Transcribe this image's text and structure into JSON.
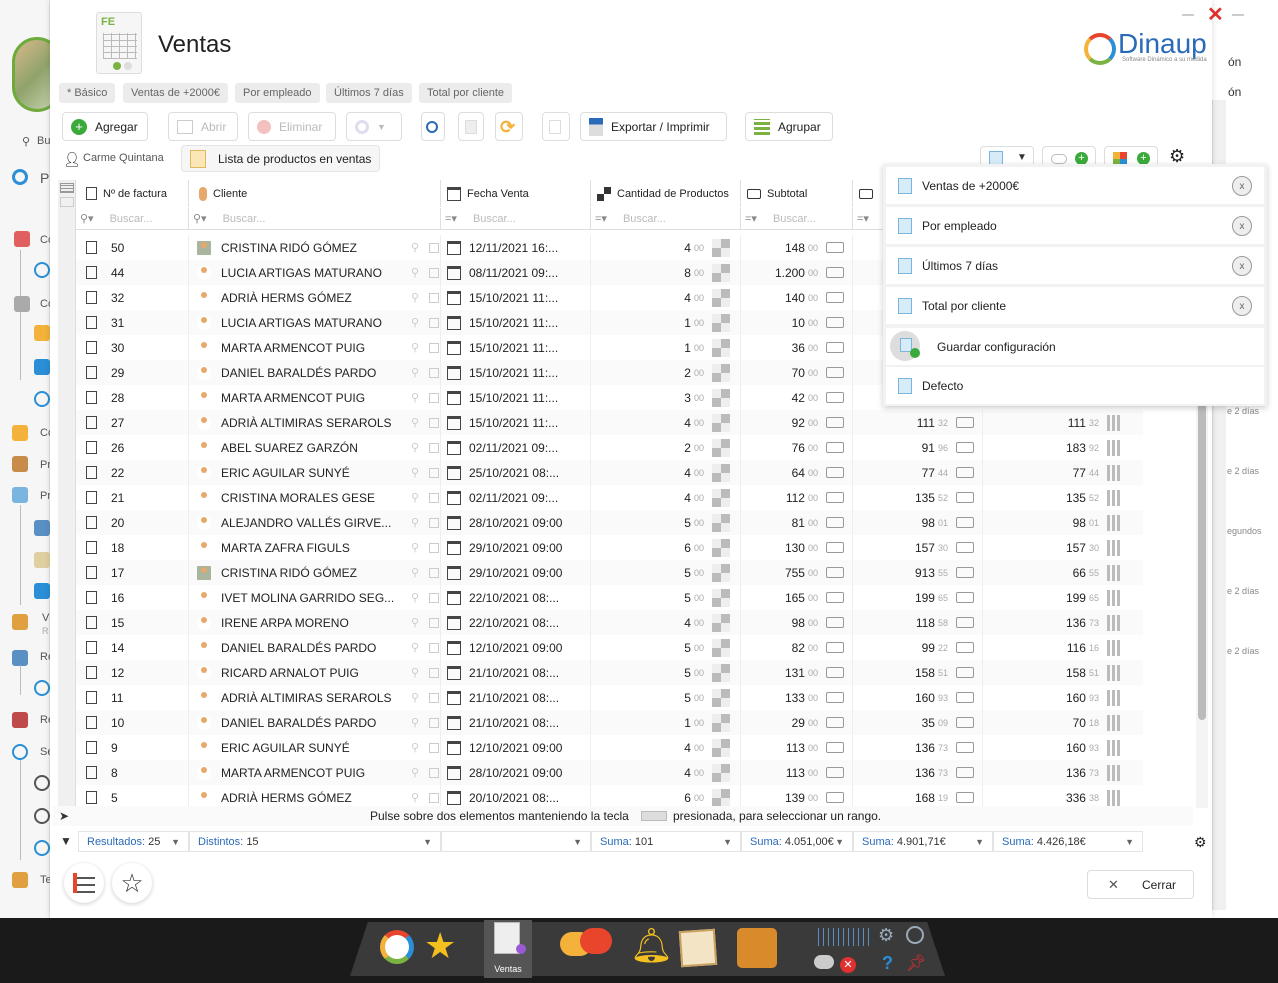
{
  "window": {
    "title": "Ventas",
    "close_icon": "close-icon",
    "brand": "Dinaup",
    "brand_tagline": "Software Dinámico a su medida"
  },
  "view_tabs": [
    "* Básico",
    "Ventas de +2000€",
    "Por empleado",
    "Últimos 7 días",
    "Total por cliente"
  ],
  "toolbar": {
    "add": "Agregar",
    "open": "Abrir",
    "delete": "Eliminar",
    "export": "Exportar / Imprimir",
    "group": "Agrupar"
  },
  "context": {
    "user": "Carme Quintana",
    "list_name": "Lista de productos en ventas"
  },
  "columns": {
    "invoice": "Nº de factura",
    "client": "Cliente",
    "date": "Fecha Venta",
    "qty": "Cantidad de Productos",
    "subtotal": "Subtotal"
  },
  "search_placeholder": "Buscar...",
  "rows": [
    {
      "id": "50",
      "client": "CRISTINA RIDÓ GÓMEZ",
      "date": "12/11/2021 16:...",
      "qty": "4",
      "sub": "148",
      "tot": "",
      "acc": ""
    },
    {
      "id": "44",
      "client": "LUCIA ARTIGAS MATURANO",
      "date": "08/11/2021 09:...",
      "qty": "8",
      "sub": "1.200",
      "tot": "",
      "acc": ""
    },
    {
      "id": "32",
      "client": "ADRIÀ HERMS GÓMEZ",
      "date": "15/10/2021 11:...",
      "qty": "4",
      "sub": "140",
      "tot": "",
      "acc": ""
    },
    {
      "id": "31",
      "client": "LUCIA ARTIGAS MATURANO",
      "date": "15/10/2021 11:...",
      "qty": "1",
      "sub": "10",
      "tot": "",
      "acc": ""
    },
    {
      "id": "30",
      "client": "MARTA ARMENCOT PUIG",
      "date": "15/10/2021 11:...",
      "qty": "1",
      "sub": "36",
      "tot": "",
      "acc": ""
    },
    {
      "id": "29",
      "client": "DANIEL BARALDÉS PARDO",
      "date": "15/10/2021 11:...",
      "qty": "2",
      "sub": "70",
      "tot": "",
      "acc": ""
    },
    {
      "id": "28",
      "client": "MARTA ARMENCOT PUIG",
      "date": "15/10/2021 11:...",
      "qty": "3",
      "sub": "42",
      "tot": "",
      "acc": ""
    },
    {
      "id": "27",
      "client": "ADRIÀ ALTIMIRAS SERAROLS",
      "date": "15/10/2021 11:...",
      "qty": "4",
      "sub": "92",
      "tot": "111",
      "totd": "32",
      "acc": "111",
      "accd": "32"
    },
    {
      "id": "26",
      "client": "ABEL SUAREZ GARZÓN",
      "date": "02/11/2021 09:...",
      "qty": "2",
      "sub": "76",
      "tot": "91",
      "totd": "96",
      "acc": "183",
      "accd": "92"
    },
    {
      "id": "22",
      "client": "ERIC AGUILAR SUNYÉ",
      "date": "25/10/2021 08:...",
      "qty": "4",
      "sub": "64",
      "tot": "77",
      "totd": "44",
      "acc": "77",
      "accd": "44"
    },
    {
      "id": "21",
      "client": "CRISTINA MORALES GESE",
      "date": "02/11/2021 09:...",
      "qty": "4",
      "sub": "112",
      "tot": "135",
      "totd": "52",
      "acc": "135",
      "accd": "52"
    },
    {
      "id": "20",
      "client": "ALEJANDRO VALLÉS GIRVE...",
      "date": "28/10/2021 09:00",
      "qty": "5",
      "sub": "81",
      "tot": "98",
      "totd": "01",
      "acc": "98",
      "accd": "01"
    },
    {
      "id": "18",
      "client": "MARTA ZAFRA FIGULS",
      "date": "29/10/2021 09:00",
      "qty": "6",
      "sub": "130",
      "tot": "157",
      "totd": "30",
      "acc": "157",
      "accd": "30"
    },
    {
      "id": "17",
      "client": "CRISTINA RIDÓ GÓMEZ",
      "date": "29/10/2021 09:00",
      "qty": "5",
      "sub": "755",
      "tot": "913",
      "totd": "55",
      "acc": "66",
      "accd": "55"
    },
    {
      "id": "16",
      "client": "IVET MOLINA GARRIDO SEG...",
      "date": "22/10/2021 08:...",
      "qty": "5",
      "sub": "165",
      "tot": "199",
      "totd": "65",
      "acc": "199",
      "accd": "65"
    },
    {
      "id": "15",
      "client": "IRENE ARPA MORENO",
      "date": "22/10/2021 08:...",
      "qty": "4",
      "sub": "98",
      "tot": "118",
      "totd": "58",
      "acc": "136",
      "accd": "73"
    },
    {
      "id": "14",
      "client": "DANIEL BARALDÉS PARDO",
      "date": "12/10/2021 09:00",
      "qty": "5",
      "sub": "82",
      "tot": "99",
      "totd": "22",
      "acc": "116",
      "accd": "16"
    },
    {
      "id": "12",
      "client": "RICARD ARNALOT PUIG",
      "date": "21/10/2021 08:...",
      "qty": "5",
      "sub": "131",
      "tot": "158",
      "totd": "51",
      "acc": "158",
      "accd": "51"
    },
    {
      "id": "11",
      "client": "ADRIÀ ALTIMIRAS SERAROLS",
      "date": "21/10/2021 08:...",
      "qty": "5",
      "sub": "133",
      "tot": "160",
      "totd": "93",
      "acc": "160",
      "accd": "93"
    },
    {
      "id": "10",
      "client": "DANIEL BARALDÉS PARDO",
      "date": "21/10/2021 08:...",
      "qty": "1",
      "sub": "29",
      "tot": "35",
      "totd": "09",
      "acc": "70",
      "accd": "18"
    },
    {
      "id": "9",
      "client": "ERIC AGUILAR SUNYÉ",
      "date": "12/10/2021 09:00",
      "qty": "4",
      "sub": "113",
      "tot": "136",
      "totd": "73",
      "acc": "160",
      "accd": "93"
    },
    {
      "id": "8",
      "client": "MARTA ARMENCOT PUIG",
      "date": "28/10/2021 09:00",
      "qty": "4",
      "sub": "113",
      "tot": "136",
      "totd": "73",
      "acc": "136",
      "accd": "73"
    },
    {
      "id": "5",
      "client": "ADRIÀ HERMS GÓMEZ",
      "date": "20/10/2021 08:...",
      "qty": "6",
      "sub": "139",
      "tot": "168",
      "totd": "19",
      "acc": "336",
      "accd": "38"
    }
  ],
  "zero_dec": "00",
  "hint": {
    "before": "Pulse sobre dos elementos manteniendo la tecla",
    "after": "presionada, para seleccionar un rango."
  },
  "footer": {
    "results_lbl": "Resultados:",
    "results": "25",
    "distinct_lbl": "Distintos:",
    "distinct": "15",
    "sum_lbl": "Suma:",
    "qty_sum": "101",
    "subtotal_sum": "4.051,00€",
    "total_sum": "4.901,71€",
    "acc_sum": "4.426,18€"
  },
  "close_button": "Cerrar",
  "dropdown": [
    "Ventas de +2000€",
    "Por empleado",
    "Últimos 7 días",
    "Total por cliente"
  ],
  "dropdown_x": "x",
  "save_config": "Guardar configuración",
  "default": "Defecto",
  "taskbar_active": "Ventas",
  "left_app": {
    "search": "Bu",
    "items": [
      "P",
      "Co",
      "Co",
      "Co",
      "Pr",
      "Pr",
      "V",
      "R",
      "Re",
      "Re",
      "Se",
      "Te"
    ]
  },
  "right_app": {
    "top1": "ón",
    "top2": "ón",
    "times": [
      "e 2 días",
      "e 2 días",
      "egundos",
      "e 2 días",
      "e 2 días"
    ]
  }
}
